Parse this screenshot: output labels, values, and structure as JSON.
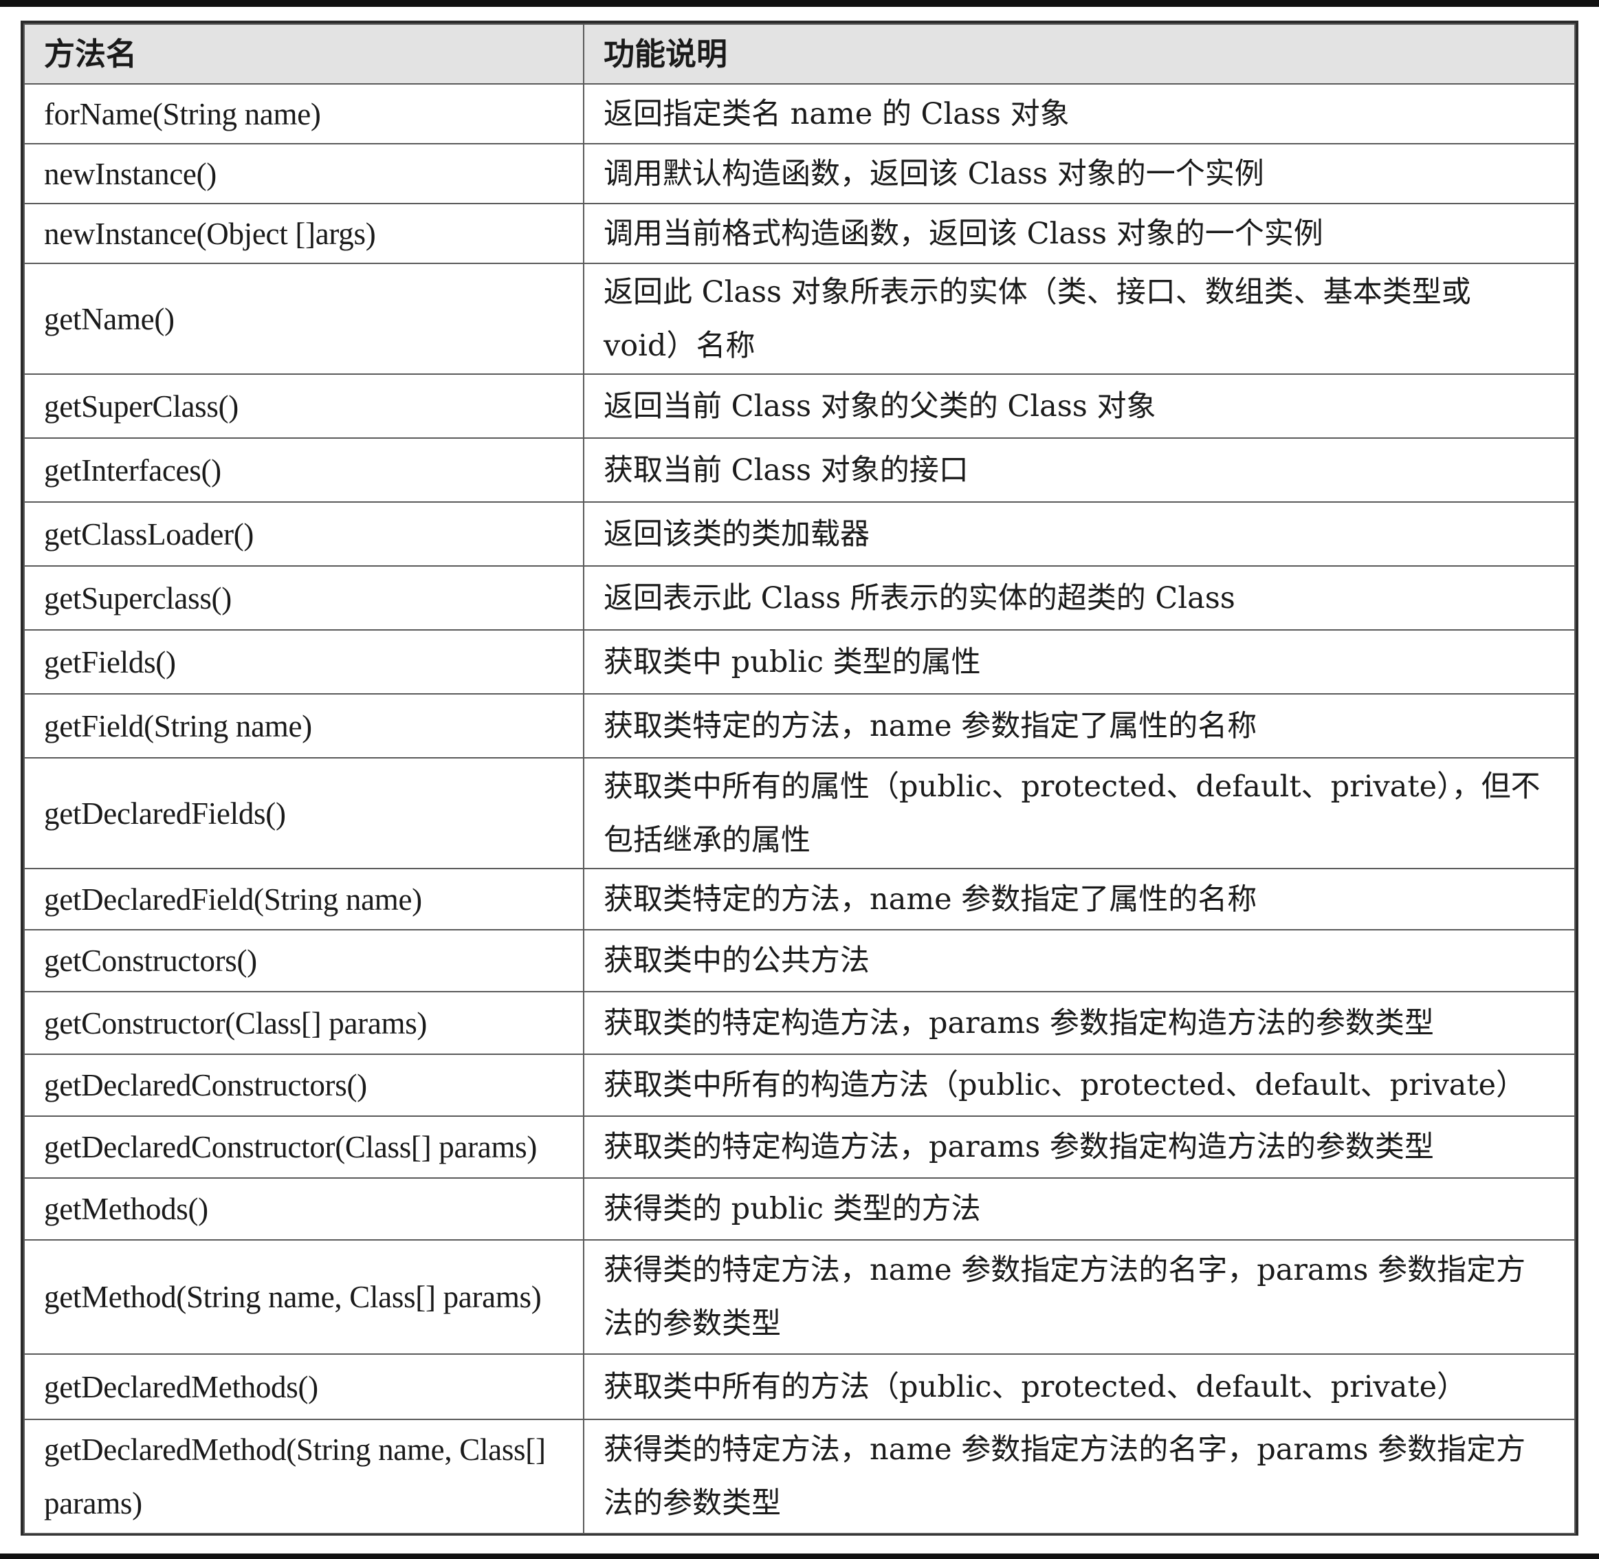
{
  "table": {
    "headers": [
      "方法名",
      "功能说明"
    ],
    "rows": [
      {
        "method": "forName(String name)",
        "description": "返回指定类名 name 的 Class 对象"
      },
      {
        "method": "newInstance()",
        "description": "调用默认构造函数，返回该 Class 对象的一个实例"
      },
      {
        "method": "newInstance(Object []args)",
        "description": "调用当前格式构造函数，返回该 Class 对象的一个实例"
      },
      {
        "method": "getName()",
        "description": "返回此 Class 对象所表示的实体（类、接口、数组类、基本类型或 void）名称"
      },
      {
        "method": "getSuperClass()",
        "description": "返回当前 Class 对象的父类的 Class 对象"
      },
      {
        "method": "getInterfaces()",
        "description": "获取当前 Class 对象的接口"
      },
      {
        "method": "getClassLoader()",
        "description": "返回该类的类加载器"
      },
      {
        "method": "getSuperclass()",
        "description": "返回表示此 Class 所表示的实体的超类的 Class"
      },
      {
        "method": "getFields()",
        "description": "获取类中 public 类型的属性"
      },
      {
        "method": "getField(String name)",
        "description": "获取类特定的方法，name 参数指定了属性的名称"
      },
      {
        "method": "getDeclaredFields()",
        "description": "获取类中所有的属性（public、protected、default、private），但不包括继承的属性"
      },
      {
        "method": "getDeclaredField(String name)",
        "description": "获取类特定的方法，name 参数指定了属性的名称"
      },
      {
        "method": "getConstructors()",
        "description": "获取类中的公共方法"
      },
      {
        "method": "getConstructor(Class[] params)",
        "description": "获取类的特定构造方法，params 参数指定构造方法的参数类型"
      },
      {
        "method": "getDeclaredConstructors()",
        "description": "获取类中所有的构造方法（public、protected、default、private）"
      },
      {
        "method": "getDeclaredConstructor(Class[] params)",
        "description": "获取类的特定构造方法，params 参数指定构造方法的参数类型"
      },
      {
        "method": "getMethods()",
        "description": "获得类的 public 类型的方法"
      },
      {
        "method": "getMethod(String name, Class[] params)",
        "description": "获得类的特定方法，name 参数指定方法的名字，params 参数指定方法的参数类型"
      },
      {
        "method": "getDeclaredMethods()",
        "description": "获取类中所有的方法（public、protected、default、private）"
      },
      {
        "method": "getDeclaredMethod(String name, Class[] params)",
        "description": "获得类的特定方法，name 参数指定方法的名字，params 参数指定方法的参数类型"
      }
    ]
  }
}
